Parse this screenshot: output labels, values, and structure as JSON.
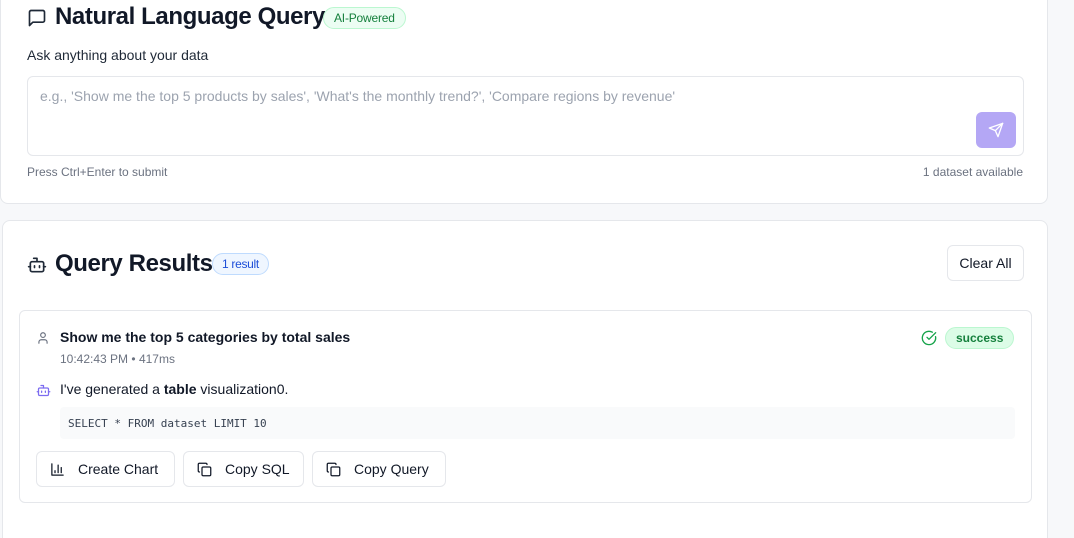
{
  "query_panel": {
    "title": "Natural Language Query",
    "badge": "AI-Powered",
    "prompt_label": "Ask anything about your data",
    "input_placeholder": "e.g., 'Show me the top 5 products by sales', 'What's the monthly trend?', 'Compare regions by revenue'",
    "submit_hint": "Press Ctrl+Enter to submit",
    "dataset_count": "1 dataset available",
    "icons": {
      "title": "message-square-icon",
      "send": "send-icon"
    },
    "colors": {
      "send_button": "#b4a7f5",
      "badge_green": "#15803d"
    }
  },
  "results_panel": {
    "title": "Query Results",
    "count_badge": "1 result",
    "clear_label": "Clear All",
    "icons": {
      "title": "bot-icon"
    },
    "results": [
      {
        "question": "Show me the top 5 categories by total sales",
        "time": "10:42:43 PM",
        "duration": "417ms",
        "separator": "•",
        "status": "success",
        "answer_prefix": "I've generated a ",
        "answer_bold": "table",
        "answer_suffix": " visualization0.",
        "sql": "SELECT * FROM dataset LIMIT 10",
        "actions": {
          "create_chart": "Create Chart",
          "copy_sql": "Copy SQL",
          "copy_query": "Copy Query"
        }
      }
    ]
  }
}
